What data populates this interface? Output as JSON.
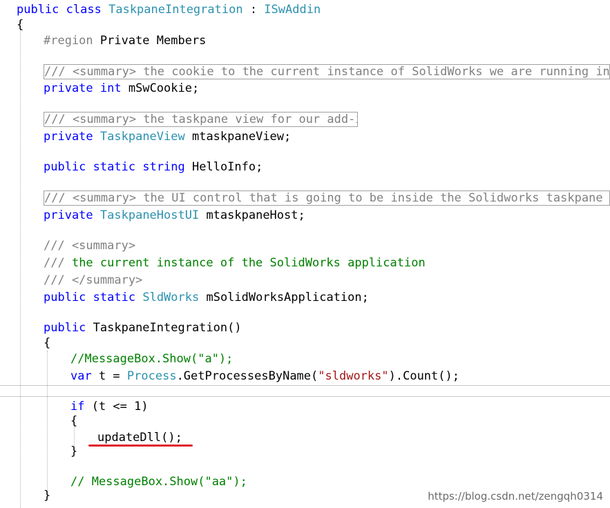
{
  "code": {
    "class_decl": {
      "kw1": "public",
      "kw2": "class",
      "name": "TaskpaneIntegration",
      "colon": " : ",
      "iface": "ISwAddin"
    },
    "open_brace": "{",
    "region": {
      "kw": "#region",
      "name": " Private Members"
    },
    "cookie_summary": "/// <summary> the cookie to the current instance of SolidWorks we are running in ...",
    "cookie_decl": {
      "kw": "private",
      "type": "int",
      "name": " mSwCookie;"
    },
    "view_summary": "/// <summary> the taskpane view for our add-in",
    "view_decl": {
      "kw": "private",
      "type": "TaskpaneView",
      "name": " mtaskpaneView;"
    },
    "hello_decl": {
      "kw1": "public",
      "kw2": "static",
      "kw3": "string",
      "name": " HelloInfo;"
    },
    "host_summary": "/// <summary> the UI control that is going to be inside the Solidworks taskpane  ...",
    "host_decl": {
      "kw": "private",
      "type": "TaskpaneHostUI",
      "name": " mtaskpaneHost;"
    },
    "app_doc1": "/// <summary>",
    "app_doc2_prefix": "/// ",
    "app_doc2_text": "the current instance of the SolidWorks application",
    "app_doc3": "/// </summary>",
    "app_decl": {
      "kw1": "public",
      "kw2": "static",
      "type": "SldWorks",
      "name": " mSolidWorksApplication;"
    },
    "ctor": {
      "kw": "public",
      "name": " TaskpaneIntegration()"
    },
    "ctor_open": "{",
    "comment1": "//MessageBox.Show(\"a\");",
    "var_line": {
      "kw": "var",
      "rest1": " t = ",
      "type": "Process",
      "rest2": ".GetProcessesByName(",
      "str": "\"sldworks\"",
      "rest3": ").Count();"
    },
    "if_line": {
      "kw": "if",
      "rest": " (t <= 1)"
    },
    "if_open": "{",
    "call": "updateDll();",
    "if_close": "}",
    "comment2": "// MessageBox.Show(\"aa\");",
    "ctor_close": "}"
  },
  "watermark": "https://blog.csdn.net/zengqh0314"
}
